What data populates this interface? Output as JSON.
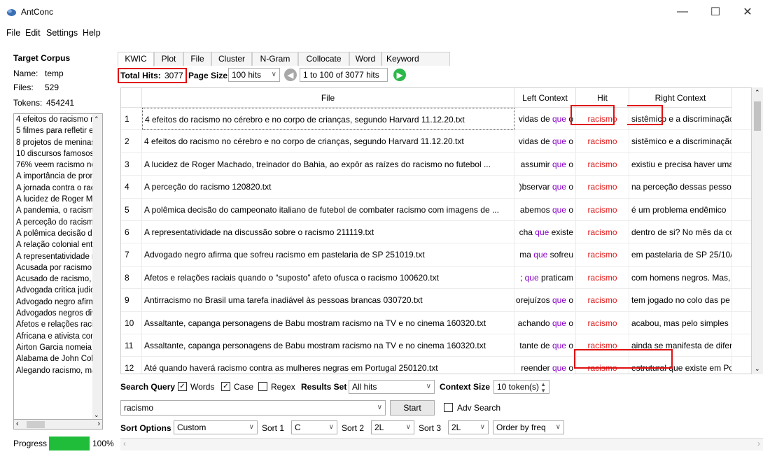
{
  "window": {
    "title": "AntConc",
    "minimize": "—",
    "maximize": "☐",
    "close": "✕"
  },
  "menu": [
    "File",
    "Edit",
    "Settings",
    "Help"
  ],
  "corpus": {
    "heading": "Target Corpus",
    "name_label": "Name:",
    "name": "temp",
    "files_label": "Files:",
    "files": "529",
    "tokens_label": "Tokens:",
    "tokens": "454241",
    "items": [
      "4 efeitos do racismo nc",
      "5 filmes para refletir e",
      "8 projetos de meninas",
      "10 discursos famosos p",
      "76% veem racismo no l",
      "A importância de prom",
      "A jornada contra o raci",
      "A lucidez de Roger Ma",
      "A pandemia, o racismo",
      "A perceção do racismo",
      "A polêmica decisão do",
      "A relação colonial entr",
      "A representatividade n",
      "Acusada por racismo e",
      "Acusado de racismo, G",
      "Advogada critica judici",
      "Advogado negro afirm",
      "Advogados negros div",
      "Afetos e relações racia",
      "Africana e ativista cont",
      "Airton Garcia nomeia r",
      "Alabama de John Coltr",
      "Alegando racismo, ma"
    ],
    "progress_label": "Progress",
    "progress_value": "100%",
    "progress_fraction": 1.0
  },
  "tabs": [
    "KWIC",
    "Plot",
    "File",
    "Cluster",
    "N-Gram",
    "Collocate",
    "Word",
    "Keyword"
  ],
  "toolbar": {
    "total_hits_label": "Total Hits:",
    "total_hits": "3077",
    "page_size_label": "Page Size",
    "page_size": "100 hits",
    "range": "1 to 100 of 3077 hits"
  },
  "table": {
    "columns": [
      "File",
      "Left Context",
      "Hit",
      "Right Context"
    ],
    "rows": [
      {
        "n": "1",
        "file": "4 efeitos do racismo no cérebro e no corpo de crianças, segundo Harvard 11.12.20.txt",
        "left_pre": "vidas de ",
        "left_kw": "que",
        "left_post": " o",
        "hit": "racismo",
        "right": "sistêmico e a discriminação"
      },
      {
        "n": "2",
        "file": "4 efeitos do racismo no cérebro e no corpo de crianças, segundo Harvard 11.12.20.txt",
        "left_pre": "vidas de ",
        "left_kw": "que",
        "left_post": " o",
        "hit": "racismo",
        "right": "sistêmico e a discriminação"
      },
      {
        "n": "3",
        "file": "A lucidez de Roger Machado, treinador do Bahia, ao expôr as raízes do racismo no futebol ...",
        "left_pre": "assumir ",
        "left_kw": "que",
        "left_post": " o",
        "hit": "racismo",
        "right": "existiu e precisa haver uma"
      },
      {
        "n": "4",
        "file": "A perceção do racismo 120820.txt",
        "left_pre": ")bservar ",
        "left_kw": "que",
        "left_post": " o",
        "hit": "racismo",
        "right": "na perceção dessas pessoa"
      },
      {
        "n": "5",
        "file": "A polêmica decisão do campeonato italiano de futebol de combater racismo com imagens de ...",
        "left_pre": "abemos ",
        "left_kw": "que",
        "left_post": " o",
        "hit": "racismo",
        "right": "é um problema endêmico"
      },
      {
        "n": "6",
        "file": "A representatividade na discussão sobre o racismo 211119.txt",
        "left_pre": "cha ",
        "left_kw": "que",
        "left_post": " existe",
        "hit": "racismo",
        "right": "dentro de si? No mês da co"
      },
      {
        "n": "7",
        "file": "Advogado negro afirma que sofreu racismo em pastelaria de SP 251019.txt",
        "left_pre": "ma ",
        "left_kw": "que",
        "left_post": " sofreu",
        "hit": "racismo",
        "right": "em pastelaria de SP 25/10/"
      },
      {
        "n": "8",
        "file": "Afetos e relações raciais quando o “suposto” afeto ofusca o racismo 100620.txt",
        "left_pre": "; ",
        "left_kw": "que",
        "left_post": " praticam",
        "hit": "racismo",
        "right": "com homens negros. Mas, p"
      },
      {
        "n": "9",
        "file": "Antirracismo no Brasil uma tarefa inadiável às pessoas brancas 030720.txt",
        "left_pre": "orejuízos ",
        "left_kw": "que",
        "left_post": " o",
        "hit": "racismo",
        "right": "tem jogado no colo das pe"
      },
      {
        "n": "10",
        "file": "Assaltante, capanga personagens de Babu mostram racismo na TV e no cinema 160320.txt",
        "left_pre": "achando ",
        "left_kw": "que",
        "left_post": " o",
        "hit": "racismo",
        "right": "acabou, mas pelo simples"
      },
      {
        "n": "11",
        "file": "Assaltante, capanga personagens de Babu mostram racismo na TV e no cinema 160320.txt",
        "left_pre": "tante de ",
        "left_kw": "que",
        "left_post": " o",
        "hit": "racismo",
        "right": "ainda se manifesta de difer"
      },
      {
        "n": "12",
        "file": "Até quando haverá racismo contra as mulheres negras em Portugal 250120.txt",
        "left_pre": "reender ",
        "left_kw": "que",
        "left_post": " o",
        "hit": "racismo",
        "right": "estrutural que existe em Po"
      }
    ]
  },
  "search": {
    "query_label": "Search Query",
    "words_label": "Words",
    "case_label": "Case",
    "regex_label": "Regex",
    "results_set_label": "Results Set",
    "results_set": "All hits",
    "context_size_label": "Context Size",
    "context_size": "10 token(s)",
    "query": "racismo",
    "start_label": "Start",
    "adv_search_label": "Adv Search"
  },
  "sort": {
    "label": "Sort Options",
    "mode": "Custom",
    "sort1_label": "Sort 1",
    "sort1": "C",
    "sort2_label": "Sort 2",
    "sort2": "2L",
    "sort3_label": "Sort 3",
    "sort3": "2L",
    "order": "Order by freq"
  },
  "colors": {
    "hit": "#e01818",
    "keyword": "#8a00c8",
    "progress": "#1fbd3a",
    "highlight": "#e01010"
  }
}
